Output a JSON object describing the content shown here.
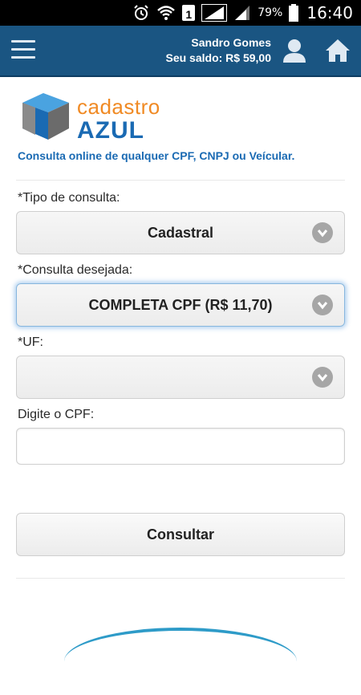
{
  "status_bar": {
    "battery_percent": "79%",
    "sim_slot": "1",
    "time": "16:40",
    "icons": [
      "alarm-icon",
      "wifi-icon",
      "sim-signal-icon",
      "signal-icon",
      "battery-icon"
    ]
  },
  "header": {
    "user_name": "Sandro Gomes",
    "balance": "Seu saldo: R$ 59,00",
    "icons": [
      "menu-icon",
      "user-icon",
      "home-icon"
    ],
    "background_color": "#1a5582"
  },
  "brand": {
    "word1": "cadastro",
    "word2": "AZUL",
    "tagline": "Consulta online de qualquer CPF, CNPJ ou Veícular."
  },
  "form": {
    "tipo_label": "*Tipo de consulta:",
    "tipo_value": "Cadastral",
    "consulta_label": "*Consulta desejada:",
    "consulta_value": "COMPLETA CPF (R$ 11,70)",
    "uf_label": "*UF:",
    "uf_value": "",
    "cpf_label": "Digite o CPF:",
    "cpf_value": "",
    "submit_label": "Consultar"
  }
}
